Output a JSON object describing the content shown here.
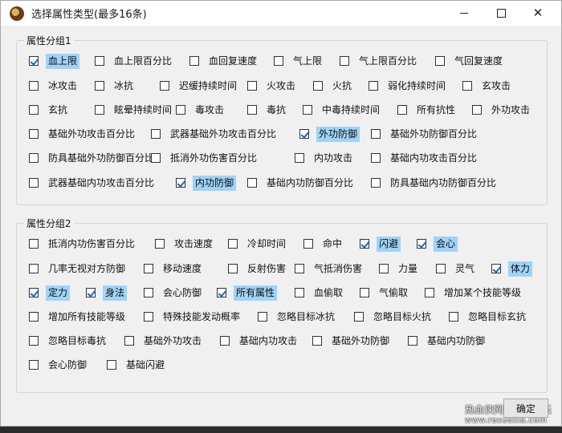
{
  "window": {
    "title": "选择属性类型(最多16条)",
    "minimize_label": "",
    "maximize_label": "",
    "close_label": "✕"
  },
  "group1": {
    "title": "属性分组1",
    "rows": [
      [
        {
          "label": "血上限",
          "checked": true
        },
        {
          "label": "血上限百分比",
          "checked": false
        },
        {
          "label": "血回复速度",
          "checked": false
        },
        {
          "label": "气上限",
          "checked": false
        },
        {
          "label": "气上限百分比",
          "checked": false
        },
        {
          "label": "气回复速度",
          "checked": false
        }
      ],
      [
        {
          "label": "冰攻击",
          "checked": false
        },
        {
          "label": "冰抗",
          "checked": false
        },
        {
          "label": "迟缓持续时间",
          "checked": false
        },
        {
          "label": "火攻击",
          "checked": false
        },
        {
          "label": "火抗",
          "checked": false
        },
        {
          "label": "弱化持续时间",
          "checked": false
        },
        {
          "label": "玄攻击",
          "checked": false
        }
      ],
      [
        {
          "label": "玄抗",
          "checked": false
        },
        {
          "label": "眩晕持续时间",
          "checked": false
        },
        {
          "label": "毒攻击",
          "checked": false
        },
        {
          "label": "毒抗",
          "checked": false
        },
        {
          "label": "中毒持续时间",
          "checked": false
        },
        {
          "label": "所有抗性",
          "checked": false
        },
        {
          "label": "外功攻击",
          "checked": false
        }
      ],
      [
        {
          "label": "基础外功攻击百分比",
          "checked": false
        },
        {
          "label": "武器基础外功攻击百分比",
          "checked": false
        },
        {
          "label": "外功防御",
          "checked": true
        },
        {
          "label": "基础外功防御百分比",
          "checked": false
        }
      ],
      [
        {
          "label": "防具基础外功防御百分比",
          "checked": false
        },
        {
          "label": "抵消外功伤害百分比",
          "checked": false
        },
        {
          "label": "内功攻击",
          "checked": false
        },
        {
          "label": "基础内功攻击百分比",
          "checked": false
        }
      ],
      [
        {
          "label": "武器基础内功攻击百分比",
          "checked": false
        },
        {
          "label": "内功防御",
          "checked": true
        },
        {
          "label": "基础内功防御百分比",
          "checked": false
        },
        {
          "label": "防具基础内功防御百分比",
          "checked": false
        }
      ]
    ]
  },
  "group2": {
    "title": "属性分组2",
    "rows": [
      [
        {
          "label": "抵消内功伤害百分比",
          "checked": false
        },
        {
          "label": "攻击速度",
          "checked": false
        },
        {
          "label": "冷却时间",
          "checked": false
        },
        {
          "label": "命中",
          "checked": false
        },
        {
          "label": "闪避",
          "checked": true
        },
        {
          "label": "会心",
          "checked": true
        }
      ],
      [
        {
          "label": "几率无视对方防御",
          "checked": false
        },
        {
          "label": "移动速度",
          "checked": false
        },
        {
          "label": "反射伤害",
          "checked": false
        },
        {
          "label": "气抵消伤害",
          "checked": false
        },
        {
          "label": "力量",
          "checked": false
        },
        {
          "label": "灵气",
          "checked": false
        },
        {
          "label": "体力",
          "checked": true
        }
      ],
      [
        {
          "label": "定力",
          "checked": true
        },
        {
          "label": "身法",
          "checked": true
        },
        {
          "label": "会心防御",
          "checked": false
        },
        {
          "label": "所有属性",
          "checked": true
        },
        {
          "label": "血偷取",
          "checked": false
        },
        {
          "label": "气偷取",
          "checked": false
        },
        {
          "label": "增加某个技能等级",
          "checked": false
        }
      ],
      [
        {
          "label": "增加所有技能等级",
          "checked": false
        },
        {
          "label": "特殊技能发动概率",
          "checked": false
        },
        {
          "label": "忽略目标冰抗",
          "checked": false
        },
        {
          "label": "忽略目标火抗",
          "checked": false
        },
        {
          "label": "忽略目标玄抗",
          "checked": false
        }
      ],
      [
        {
          "label": "忽略目标毒抗",
          "checked": false
        },
        {
          "label": "基础外功攻击",
          "checked": false
        },
        {
          "label": "基础内功攻击",
          "checked": false
        },
        {
          "label": "基础外功防御",
          "checked": false
        },
        {
          "label": "基础内功防御",
          "checked": false
        }
      ],
      [
        {
          "label": "会心防御",
          "checked": false
        },
        {
          "label": "基础闪避",
          "checked": false
        }
      ]
    ]
  },
  "footer": {
    "ok_label": "确定",
    "watermark_line1": "热血侠网游单机论坛",
    "watermark_line2": "www.rexuexia.com"
  }
}
